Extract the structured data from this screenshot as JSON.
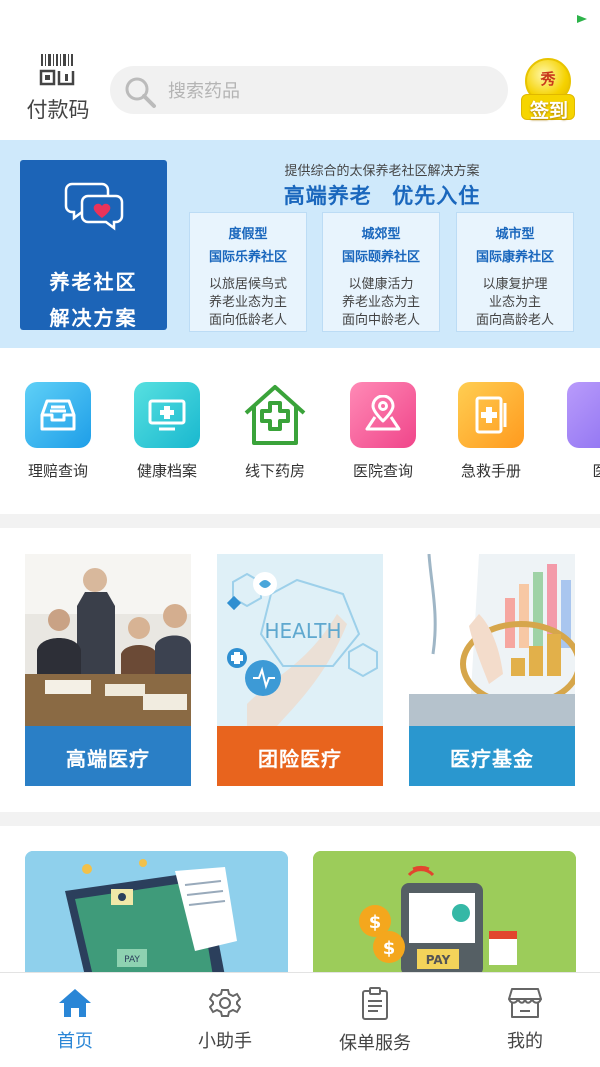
{
  "top": {
    "paycode_label": "付款码",
    "search_placeholder": "搜索药品",
    "checkin_badge": "秀",
    "checkin_label": "签到"
  },
  "banner": {
    "left_title": "养老社区",
    "left_subtitle": "解决方案",
    "top_line": "提供综合的太保养老社区解决方案",
    "slogan": "高端养老   优先入住",
    "cards": [
      {
        "type": "度假型",
        "name": "国际乐养社区",
        "desc1": "以旅居候鸟式",
        "desc2": "养老业态为主",
        "desc3": "面向低龄老人"
      },
      {
        "type": "城郊型",
        "name": "国际颐养社区",
        "desc1": "以健康活力",
        "desc2": "养老业态为主",
        "desc3": "面向中龄老人"
      },
      {
        "type": "城市型",
        "name": "国际康养社区",
        "desc1": "以康复护理",
        "desc2": "业态为主",
        "desc3": "面向高龄老人"
      }
    ]
  },
  "shortcuts": [
    {
      "label": "理赔查询",
      "icon": "inbox-icon"
    },
    {
      "label": "健康档案",
      "icon": "health-record-icon"
    },
    {
      "label": "线下药房",
      "icon": "pharmacy-house-icon"
    },
    {
      "label": "医院查询",
      "icon": "location-pin-icon"
    },
    {
      "label": "急救手册",
      "icon": "first-aid-book-icon"
    },
    {
      "label": "医",
      "icon": "partial-icon"
    }
  ],
  "products": [
    {
      "label": "高端医疗",
      "color": "#2a7fc6"
    },
    {
      "label": "团险医疗",
      "color": "#e8641e"
    },
    {
      "label": "医疗基金",
      "color": "#2a97cf"
    }
  ],
  "product_images": {
    "health_text": "HEALTH"
  },
  "promo": {
    "pay_text_1": "PAY",
    "pay_text_2": "PAY"
  },
  "tabs": [
    {
      "label": "首页",
      "active": true
    },
    {
      "label": "小助手",
      "active": false
    },
    {
      "label": "保单服务",
      "active": false
    },
    {
      "label": "我的",
      "active": false
    }
  ],
  "colors": {
    "accent": "#2a86d6",
    "banner_blue": "#1c64b7",
    "banner_bg": "#cfe9fb"
  }
}
